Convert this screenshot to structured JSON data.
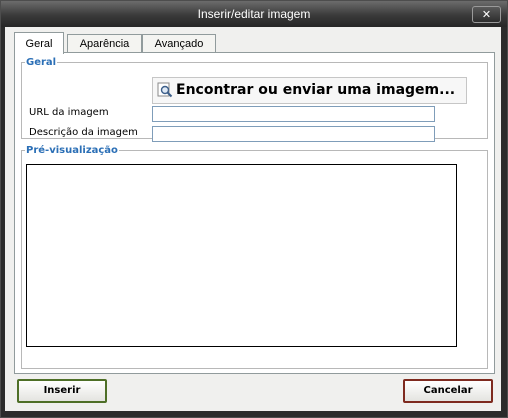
{
  "dialog": {
    "title": "Inserir/editar imagem",
    "close_icon": "close-icon"
  },
  "tabs": [
    {
      "label": "Geral",
      "active": true
    },
    {
      "label": "Aparência",
      "active": false
    },
    {
      "label": "Avançado",
      "active": false
    }
  ],
  "general": {
    "legend": "Geral",
    "find_button_label": "Encontrar ou enviar uma imagem...",
    "find_button_icon": "search-icon",
    "url_label": "URL da imagem",
    "url_value": "",
    "description_label": "Descrição da imagem",
    "description_value": ""
  },
  "preview": {
    "legend": "Pré-visualização"
  },
  "footer": {
    "insert_label": "Inserir",
    "cancel_label": "Cancelar"
  },
  "colors": {
    "legend": "#2b6fb6",
    "insert_border": "#4e6f27",
    "cancel_border": "#7e2a1f",
    "titlebar": "#3a3a3a"
  }
}
